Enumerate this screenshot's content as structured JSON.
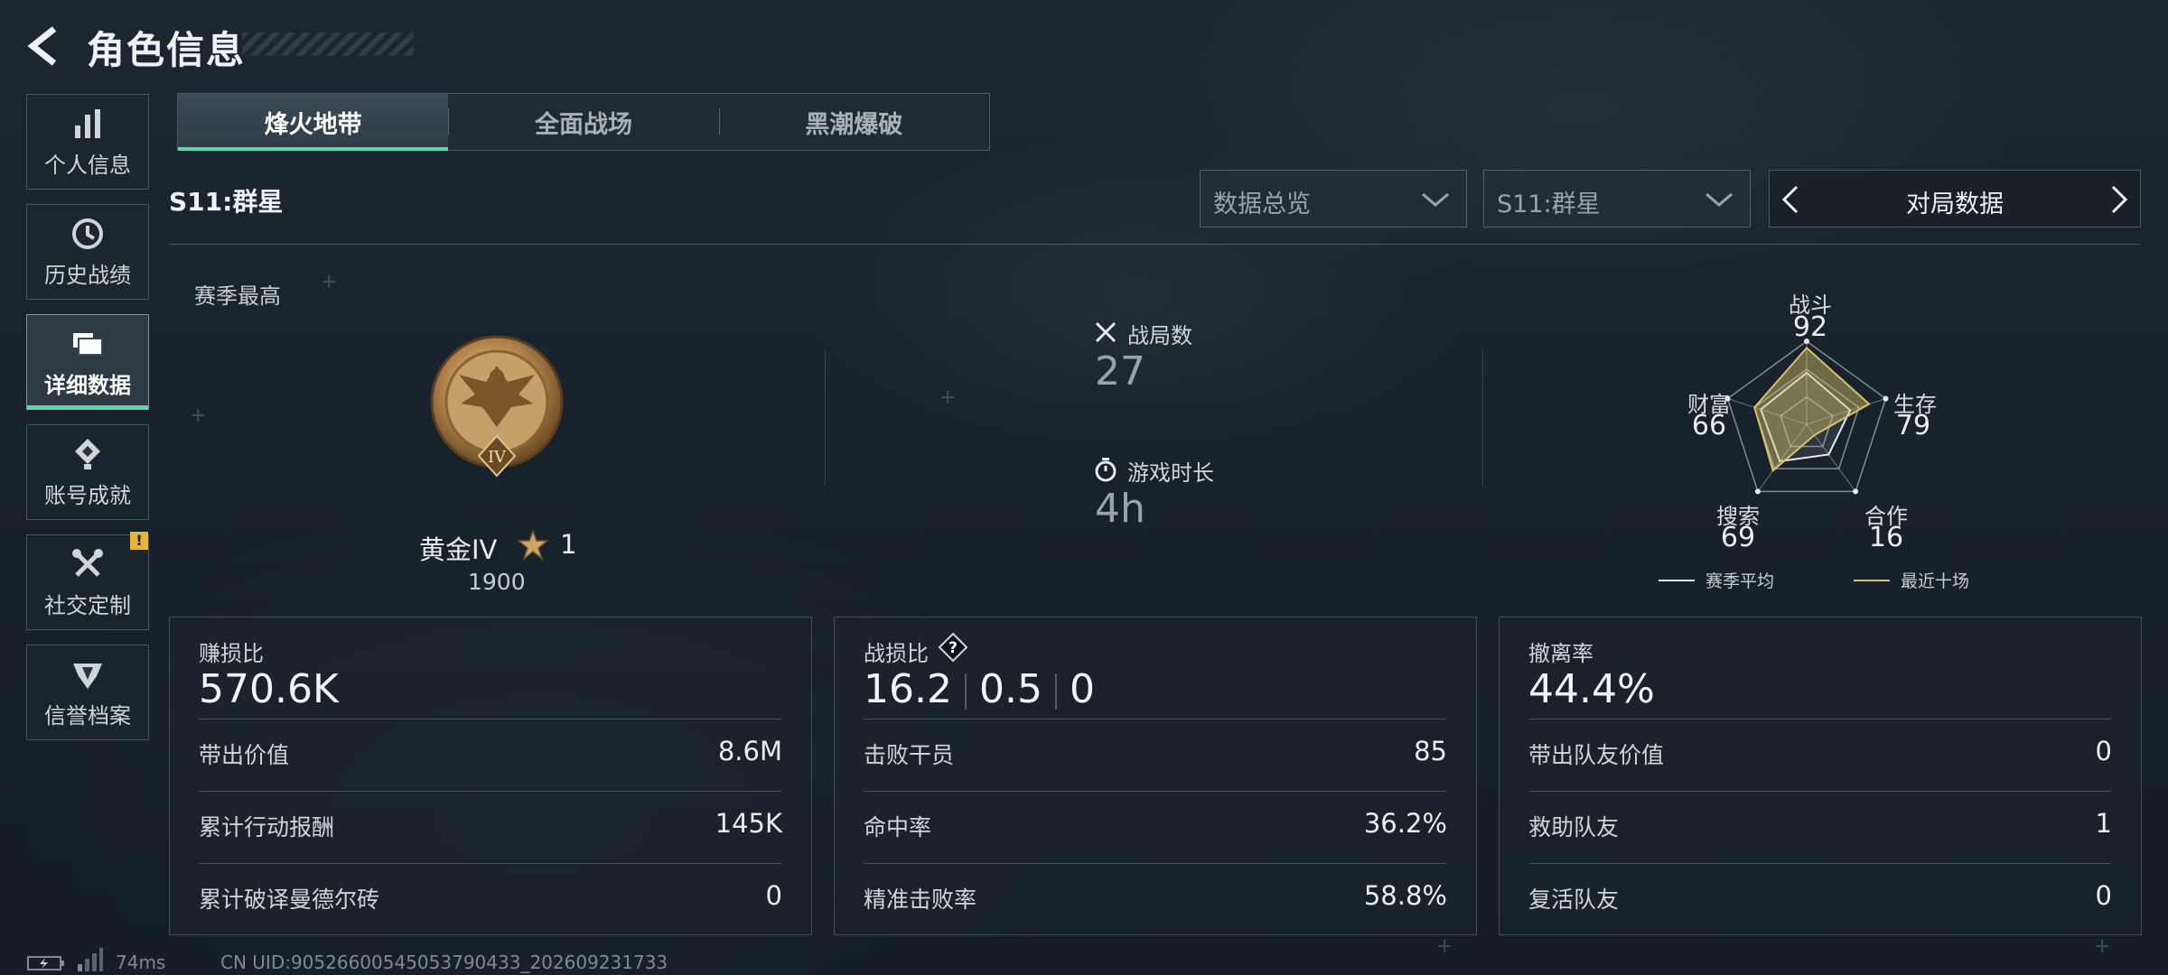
{
  "header": {
    "title": "角色信息"
  },
  "sidebar": {
    "items": [
      {
        "label": "个人信息",
        "icon": "bar-chart-icon"
      },
      {
        "label": "历史战绩",
        "icon": "history-icon"
      },
      {
        "label": "详细数据",
        "icon": "folders-icon",
        "active": true
      },
      {
        "label": "账号成就",
        "icon": "achievement-icon"
      },
      {
        "label": "社交定制",
        "icon": "tools-icon",
        "badge": "!"
      },
      {
        "label": "信誉档案",
        "icon": "reputation-icon"
      }
    ]
  },
  "tabs": [
    {
      "label": "烽火地带",
      "active": true
    },
    {
      "label": "全面战场"
    },
    {
      "label": "黑潮爆破"
    }
  ],
  "season_title": "S11:群星",
  "filters": {
    "data_type": "数据总览",
    "season": "S11:群星",
    "mode": "对局数据"
  },
  "rank": {
    "section_label": "赛季最高",
    "name": "黄金IV",
    "stars": "1",
    "score": "1900"
  },
  "summary": {
    "matches_label": "战局数",
    "matches_value": "27",
    "playtime_label": "游戏时长",
    "playtime_value": "4h"
  },
  "radar": {
    "axes": [
      {
        "label": "战斗",
        "value": "92"
      },
      {
        "label": "生存",
        "value": "79"
      },
      {
        "label": "合作",
        "value": "16"
      },
      {
        "label": "搜索",
        "value": "69"
      },
      {
        "label": "财富",
        "value": "66"
      }
    ],
    "season_avg": [
      62,
      55,
      45,
      55,
      58
    ],
    "recent": [
      92,
      79,
      16,
      69,
      66
    ],
    "legend": {
      "season_avg": "赛季平均",
      "recent": "最近十场"
    },
    "colors": {
      "season_avg": "#e6ebee",
      "recent": "#d8c26a"
    }
  },
  "panels": {
    "profit": {
      "title": "赚损比",
      "value": "570.6K",
      "rows": [
        {
          "label": "带出价值",
          "value": "8.6M"
        },
        {
          "label": "累计行动报酬",
          "value": "145K"
        },
        {
          "label": "累计破译曼德尔砖",
          "value": "0"
        }
      ]
    },
    "combat": {
      "title": "战损比",
      "values": [
        "16.2",
        "0.5",
        "0"
      ],
      "rows": [
        {
          "label": "击败干员",
          "value": "85"
        },
        {
          "label": "命中率",
          "value": "36.2%"
        },
        {
          "label": "精准击败率",
          "value": "58.8%"
        }
      ]
    },
    "extract": {
      "title": "撤离率",
      "value": "44.4%",
      "rows": [
        {
          "label": "带出队友价值",
          "value": "0"
        },
        {
          "label": "救助队友",
          "value": "1"
        },
        {
          "label": "复活队友",
          "value": "0"
        }
      ]
    }
  },
  "footer": {
    "ping": "74ms",
    "uid": "CN UID:9052660054505379043​3_202609231733"
  },
  "accent": "#5ed6a6"
}
